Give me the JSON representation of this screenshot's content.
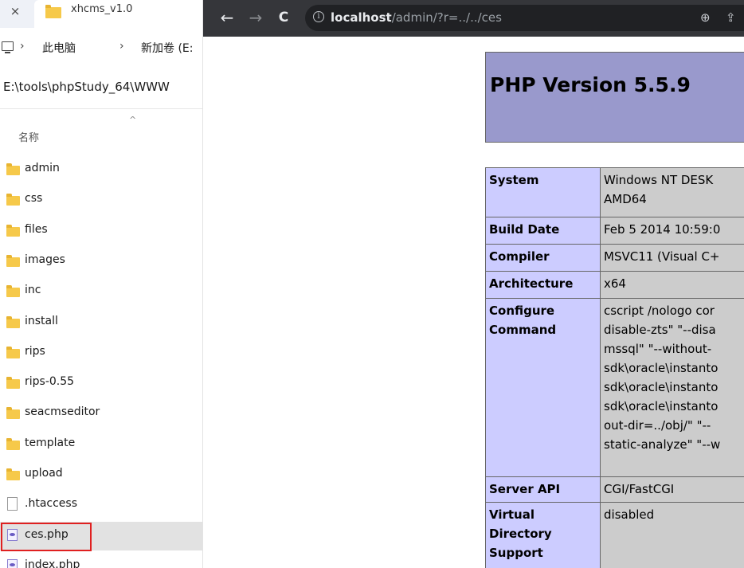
{
  "explorer": {
    "tab_title": "xhcms_v1.0",
    "close_glyph": "×",
    "breadcrumb": {
      "sep": "›",
      "items": [
        "此电脑",
        "新加卷 (E:"
      ]
    },
    "address": "E:\\tools\\phpStudy_64\\WWW",
    "column_name": "名称",
    "sort_glyph": "^",
    "files": [
      {
        "name": "admin",
        "type": "folder"
      },
      {
        "name": "css",
        "type": "folder"
      },
      {
        "name": "files",
        "type": "folder"
      },
      {
        "name": "images",
        "type": "folder"
      },
      {
        "name": "inc",
        "type": "folder"
      },
      {
        "name": "install",
        "type": "folder"
      },
      {
        "name": "rips",
        "type": "folder"
      },
      {
        "name": "rips-0.55",
        "type": "folder"
      },
      {
        "name": "seacmseditor",
        "type": "folder"
      },
      {
        "name": "template",
        "type": "folder"
      },
      {
        "name": "upload",
        "type": "folder"
      },
      {
        "name": ".htaccess",
        "type": "file"
      },
      {
        "name": "ces.php",
        "type": "php",
        "selected": true
      },
      {
        "name": "index.php",
        "type": "php"
      }
    ]
  },
  "browser": {
    "back_glyph": "←",
    "forward_glyph": "→",
    "reload_glyph": "C",
    "info_glyph": "i",
    "url_host": "localhost",
    "url_path": "/admin/?r=../../ces",
    "zoom_glyph": "⊕",
    "share_glyph": "⇪"
  },
  "phpinfo": {
    "title": "PHP Version 5.5.9",
    "rows": [
      {
        "key": "System",
        "lines": [
          "Windows NT DESK",
          "AMD64"
        ]
      },
      {
        "key": "Build Date",
        "lines": [
          "Feb 5 2014 10:59:0"
        ]
      },
      {
        "key": "Compiler",
        "lines": [
          "MSVC11 (Visual C+"
        ]
      },
      {
        "key": "Architecture",
        "lines": [
          "x64"
        ]
      },
      {
        "key": "Configure Command",
        "lines": [
          "cscript /nologo cor",
          "disable-zts\" \"--disa",
          "mssql\" \"--without-",
          "sdk\\oracle\\instanto",
          "sdk\\oracle\\instanto",
          "sdk\\oracle\\instanto",
          "out-dir=../obj/\" \"--",
          "static-analyze\" \"--w"
        ]
      },
      {
        "key": "Server API",
        "lines": [
          "CGI/FastCGI"
        ]
      },
      {
        "key": "Virtual Directory Support",
        "lines": [
          "disabled"
        ]
      },
      {
        "key": "",
        "lines": [
          ""
        ]
      }
    ]
  }
}
